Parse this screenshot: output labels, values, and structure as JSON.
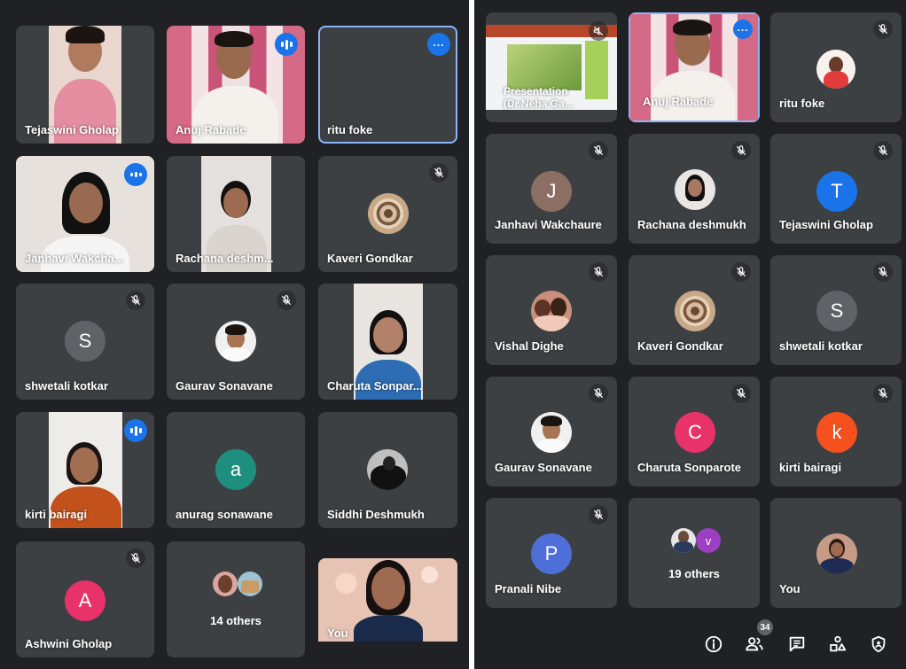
{
  "left_panel": {
    "tiles": [
      {
        "name": "Tejaswini Gholap"
      },
      {
        "name": "Anuj Rabade"
      },
      {
        "name": "ritu foke"
      },
      {
        "name": "Janhavi Wakcha..."
      },
      {
        "name": "Rachana deshm..."
      },
      {
        "name": "Kaveri Gondkar"
      },
      {
        "name": "shwetali kotkar",
        "initial": "S"
      },
      {
        "name": "Gaurav Sonavane"
      },
      {
        "name": "Charuta Sonpar..."
      },
      {
        "name": "kirti bairagi"
      },
      {
        "name": "anurag sonawane",
        "initial": "a"
      },
      {
        "name": "Siddhi Deshmukh"
      },
      {
        "name": "Ashwini Gholap",
        "initial": "A"
      },
      {
        "name": "14 others"
      },
      {
        "name": "You"
      }
    ]
  },
  "right_panel": {
    "tiles": [
      {
        "name": "Presentation\n(Dr.Neha Ga..."
      },
      {
        "name": "Anuj Rabade"
      },
      {
        "name": "ritu foke"
      },
      {
        "name": "Janhavi Wakchaure",
        "initial": "J"
      },
      {
        "name": "Rachana deshmukh"
      },
      {
        "name": "Tejaswini Gholap",
        "initial": "T"
      },
      {
        "name": "Vishal Dighe"
      },
      {
        "name": "Kaveri Gondkar"
      },
      {
        "name": "shwetali kotkar",
        "initial": "S"
      },
      {
        "name": "Gaurav Sonavane"
      },
      {
        "name": "Charuta Sonparote",
        "initial": "C"
      },
      {
        "name": "kirti bairagi",
        "initial": "k"
      },
      {
        "name": "Pranali Nibe",
        "initial": "P"
      },
      {
        "name": "19 others",
        "initial": "v"
      },
      {
        "name": "You"
      }
    ]
  },
  "toolbar": {
    "participant_count": "34"
  },
  "colors": {
    "background": "#202124",
    "tile": "#3c4043",
    "accent": "#1a73e8",
    "outline": "#8ab4f8",
    "avatar_shwetali": "#5f6368",
    "avatar_anurag": "#1e8e7e",
    "avatar_ashwini": "#e8336a",
    "avatar_janhavi": "#8d6e63",
    "avatar_tejaswini": "#1a73e8",
    "avatar_charuta": "#e8336a",
    "avatar_kirti": "#f4511e",
    "avatar_pranali": "#4f6fd8",
    "avatar_v": "#9c3fc2"
  },
  "icons": [
    "mic-off-icon",
    "more-options-icon",
    "audio-level-icon",
    "info-icon",
    "people-icon",
    "chat-icon",
    "activities-icon",
    "host-controls-icon"
  ]
}
